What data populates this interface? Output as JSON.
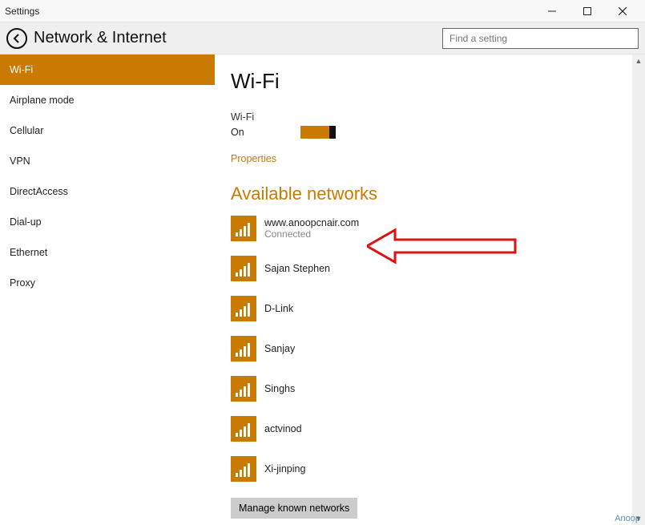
{
  "window": {
    "title": "Settings"
  },
  "header": {
    "title": "Network & Internet",
    "search_placeholder": "Find a setting"
  },
  "sidebar": {
    "items": [
      {
        "label": "Wi-Fi",
        "selected": true
      },
      {
        "label": "Airplane mode",
        "selected": false
      },
      {
        "label": "Cellular",
        "selected": false
      },
      {
        "label": "VPN",
        "selected": false
      },
      {
        "label": "DirectAccess",
        "selected": false
      },
      {
        "label": "Dial-up",
        "selected": false
      },
      {
        "label": "Ethernet",
        "selected": false
      },
      {
        "label": "Proxy",
        "selected": false
      }
    ]
  },
  "main": {
    "heading": "Wi-Fi",
    "wifi_label": "Wi-Fi",
    "wifi_state": "On",
    "properties_link": "Properties",
    "available_heading": "Available networks",
    "networks": [
      {
        "name": "www.anoopcnair.com",
        "status": "Connected"
      },
      {
        "name": "Sajan Stephen",
        "status": ""
      },
      {
        "name": "D-Link",
        "status": ""
      },
      {
        "name": "Sanjay",
        "status": ""
      },
      {
        "name": "Singhs",
        "status": ""
      },
      {
        "name": "actvinod",
        "status": ""
      },
      {
        "name": "Xi-jinping",
        "status": ""
      }
    ],
    "manage_link": "Manage known networks"
  },
  "watermark": "Anoop",
  "colors": {
    "accent": "#c87b00"
  }
}
